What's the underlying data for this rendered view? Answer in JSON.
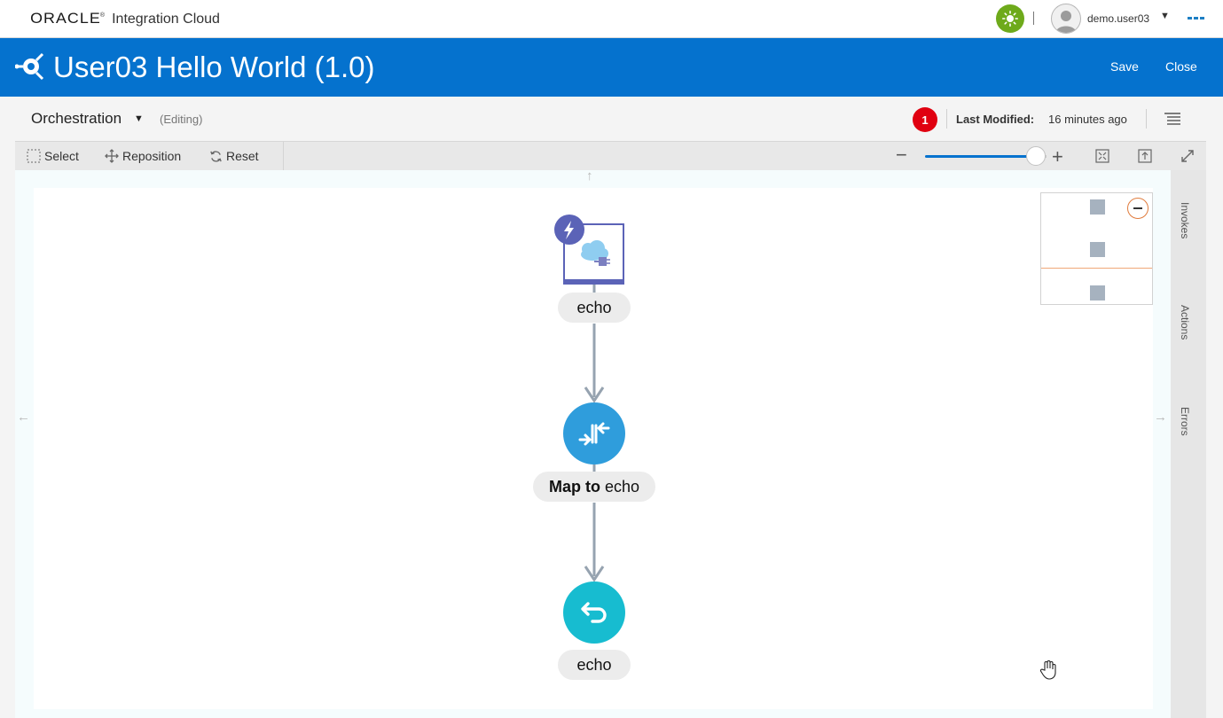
{
  "topbar": {
    "brand": "ORACLE",
    "brand_mark": "®",
    "product": "Integration Cloud",
    "status_icon": "sun-icon",
    "user": "demo.user03",
    "user_caret": "▼",
    "more_icon": "more-icon"
  },
  "header": {
    "icon": "integration-icon",
    "title": "User03 Hello World (1.0)",
    "save_label": "Save",
    "close_label": "Close",
    "color": "#0572ce"
  },
  "orchestration": {
    "title": "Orchestration",
    "caret": "▼",
    "mode": "(Editing)",
    "error_count": "1",
    "last_modified_label": "Last Modified:",
    "last_modified_value": "16 minutes ago"
  },
  "toolbar": {
    "select_label": "Select",
    "reposition_label": "Reposition",
    "reset_label": "Reset",
    "zoom_minus": "−",
    "zoom_plus": "+",
    "zoom_level": 0.9
  },
  "canvas": {
    "arrow_up": "↑",
    "arrow_left": "←",
    "arrow_right": "→",
    "nodes": [
      {
        "type": "trigger",
        "label": "echo",
        "icon": "lightning-icon"
      },
      {
        "type": "map",
        "label_bold": "Map to",
        "label": "echo",
        "icon": "map-arrows-icon"
      },
      {
        "type": "return",
        "label": "echo",
        "icon": "return-arrow-icon"
      }
    ]
  },
  "side_panel": {
    "tabs": [
      "Invokes",
      "Actions",
      "Errors"
    ]
  },
  "colors": {
    "trigger_frame": "#5b63b7",
    "map_node": "#2f9ddc",
    "return_node": "#17bcd0",
    "connector": "#96a3b0",
    "error": "#e00010"
  }
}
